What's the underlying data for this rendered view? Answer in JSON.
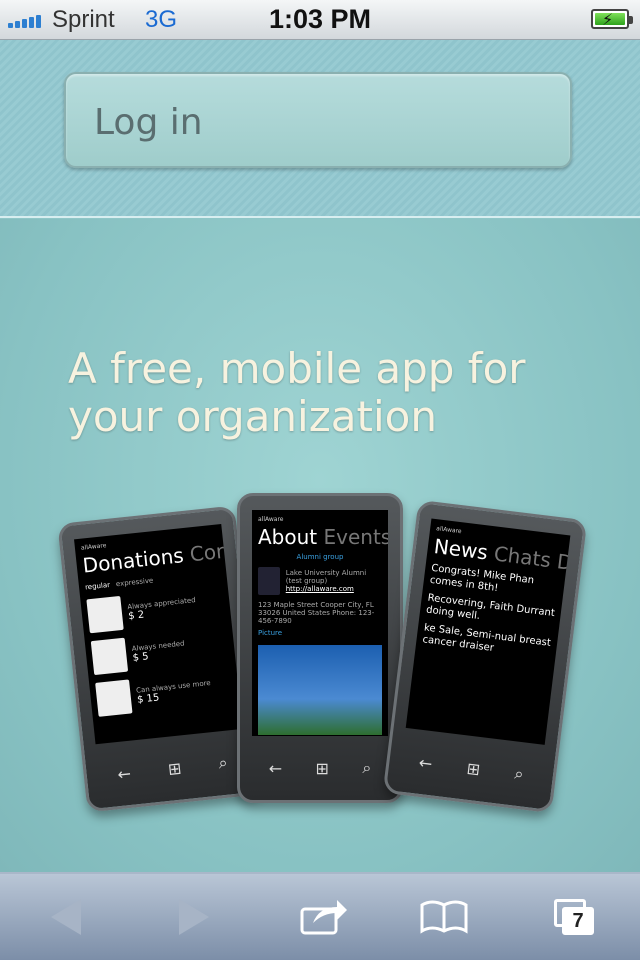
{
  "status_bar": {
    "carrier": "Sprint",
    "network": "3G",
    "time": "1:03 PM",
    "battery_icon": "battery-charging-icon",
    "signal_bars": 5
  },
  "header": {
    "login_label": "Log in"
  },
  "main": {
    "headline": "A free, mobile app for your organization",
    "phones": [
      {
        "app": "allAware",
        "title": "Donations",
        "title_dim": "Con",
        "tabs": [
          "regular",
          "expressive"
        ],
        "items": [
          {
            "note": "Always appreciated",
            "price": "$ 2"
          },
          {
            "note": "Always needed",
            "price": "$ 5"
          },
          {
            "note": "Can always use more",
            "price": "$ 15"
          }
        ]
      },
      {
        "app": "allAware",
        "title": "About",
        "title_dim": "Events E",
        "group_label": "Alumni group",
        "org_name": "Lake University Alumni (test group)",
        "link": "http://allaware.com",
        "address": "123 Maple Street Cooper City, FL 33026 United States Phone: 123-456-7890",
        "picture_label": "Picture"
      },
      {
        "app": "allAware",
        "title": "News",
        "title_dim": "Chats Do",
        "news": [
          "Congrats! Mike Phan comes in 8th!",
          "Recovering, Faith Durrant doing well.",
          "ke Sale, Semi-nual breast cancer draiser"
        ]
      }
    ]
  },
  "toolbar": {
    "back_icon": "back-arrow-icon",
    "forward_icon": "forward-arrow-icon",
    "share_icon": "share-icon",
    "bookmarks_icon": "bookmarks-icon",
    "pages_icon": "pages-icon",
    "pages_count": "7"
  },
  "colors": {
    "background": "#8fc6c7",
    "headline": "#f7f2df",
    "toolbar": "#8b9cb4",
    "network": "#1a6ad2"
  }
}
